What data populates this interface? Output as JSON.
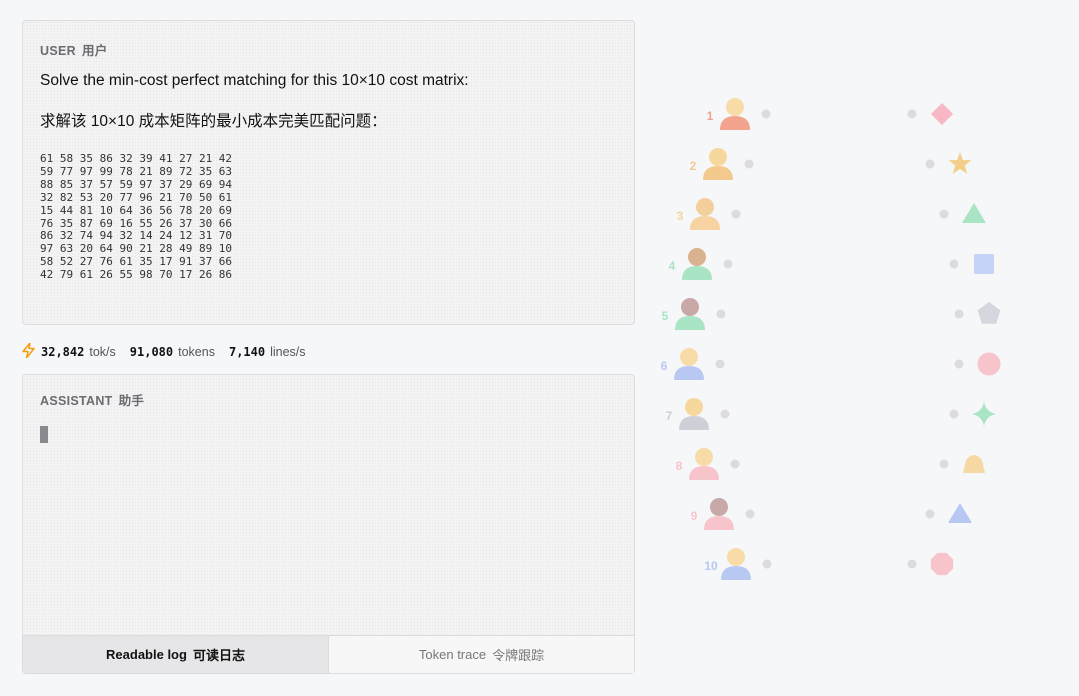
{
  "user": {
    "role": "USER",
    "role_cn": "用户",
    "prompt_en": "Solve the min-cost perfect matching for this 10×10 cost matrix:",
    "prompt_cn": "求解该 10×10 成本矩阵的最小成本完美匹配问题：",
    "matrix_rows": [
      "61 58 35 86 32 39 41 27 21 42",
      "59 77 97 99 78 21 89 72 35 63",
      "88 85 37 57 59 97 37 29 69 94",
      "32 82 53 20 77 96 21 70 50 61",
      "15 44 81 10 64 36 56 78 20 69",
      "76 35 87 69 16 55 26 37 30 66",
      "86 32 74 94 32 14 24 12 31 70",
      "97 63 20 64 90 21 28 49 89 10",
      "58 52 27 76 61 35 17 91 37 66",
      "42 79 61 26 55 98 70 17 26 86"
    ]
  },
  "stats": {
    "icon": "lightning-icon",
    "tok_s": "32,842",
    "tok_s_unit": "tok/s",
    "tokens": "91,080",
    "tokens_unit": "tokens",
    "lines_s": "7,140",
    "lines_s_unit": "lines/s"
  },
  "assistant": {
    "role": "ASSISTANT",
    "role_cn": "助手"
  },
  "tabs": [
    {
      "label": "Readable log",
      "label_cn": "可读日志",
      "active": true
    },
    {
      "label": "Token trace",
      "label_cn": "令牌跟踪",
      "active": false
    }
  ],
  "matching": {
    "agents": [
      {
        "label": "1",
        "color": "#f2a48e",
        "head": "#f8dca8",
        "icon": "person-icon"
      },
      {
        "label": "2",
        "color": "#f4c98e",
        "head": "#f6d89c",
        "icon": "person-icon"
      },
      {
        "label": "3",
        "color": "#f6d3a0",
        "head": "#f3cf9c",
        "icon": "person-icon"
      },
      {
        "label": "4",
        "color": "#a9e4c4",
        "head": "#d9b38f",
        "icon": "person-icon"
      },
      {
        "label": "5",
        "color": "#a9e4c4",
        "head": "#c9a8a8",
        "icon": "person-icon"
      },
      {
        "label": "6",
        "color": "#b8c8f2",
        "head": "#f8dca8",
        "icon": "person-icon"
      },
      {
        "label": "7",
        "color": "#cfcfd8",
        "head": "#f6d89c",
        "icon": "person-icon"
      },
      {
        "label": "8",
        "color": "#f8c4cc",
        "head": "#f8dca8",
        "icon": "person-icon"
      },
      {
        "label": "9",
        "color": "#f8c4cc",
        "head": "#c9a8a8",
        "icon": "person-icon"
      },
      {
        "label": "10",
        "color": "#b8c8f2",
        "head": "#f8dca8",
        "icon": "person-icon"
      }
    ],
    "tasks": [
      {
        "shape": "diamond",
        "color": "#f7b7c4",
        "icon": "diamond-icon"
      },
      {
        "shape": "star",
        "color": "#f4cf8a",
        "icon": "star-icon"
      },
      {
        "shape": "triangle",
        "color": "#a9e4c4",
        "icon": "triangle-icon"
      },
      {
        "shape": "square",
        "color": "#c6d2f6",
        "icon": "square-icon"
      },
      {
        "shape": "pentagon",
        "color": "#d6d6de",
        "icon": "pentagon-icon"
      },
      {
        "shape": "circle",
        "color": "#f8c4cc",
        "icon": "circle-icon"
      },
      {
        "shape": "sparkle",
        "color": "#a9e4c4",
        "icon": "sparkle-icon"
      },
      {
        "shape": "bell",
        "color": "#f6d8a4",
        "icon": "bell-icon"
      },
      {
        "shape": "triangle",
        "color": "#b8c8f2",
        "icon": "triangle-icon"
      },
      {
        "shape": "octagon",
        "color": "#f8c4cc",
        "icon": "octagon-icon"
      }
    ]
  }
}
